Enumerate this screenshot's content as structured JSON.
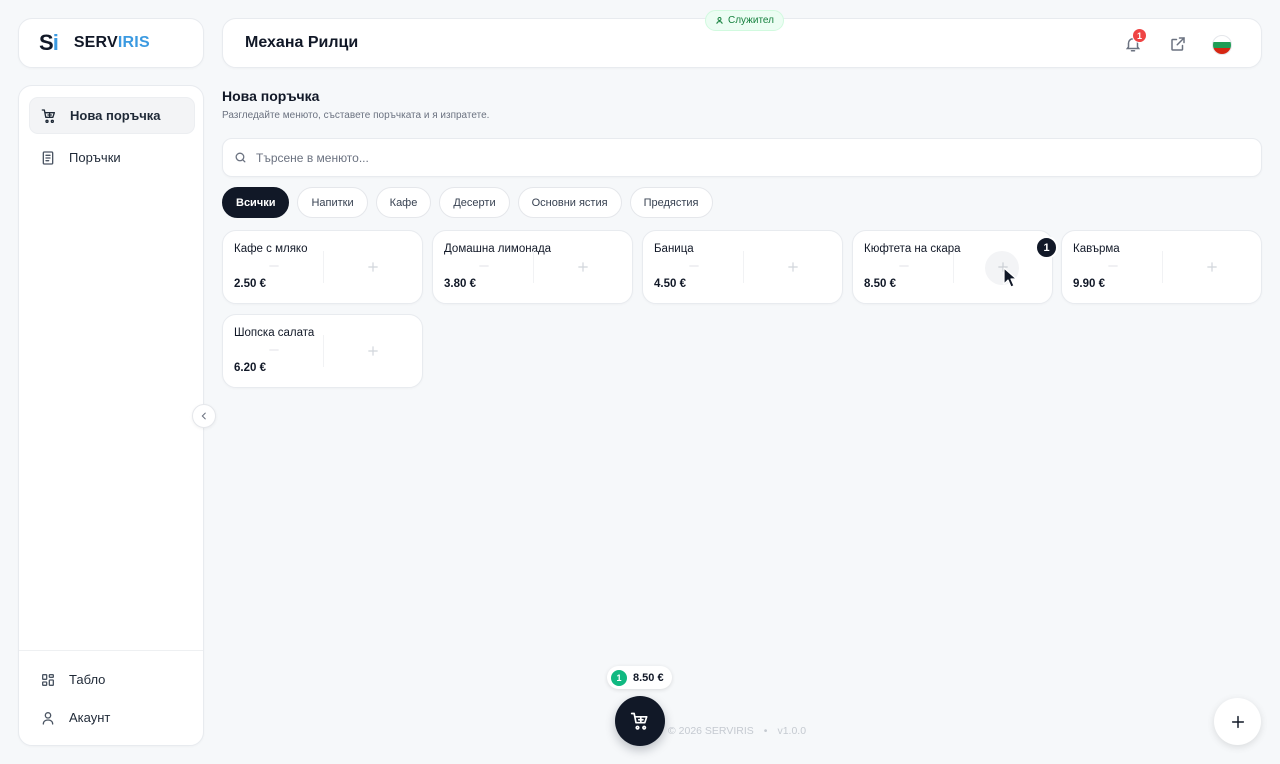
{
  "brand": {
    "mark": "S",
    "mark_accent": "i",
    "name_a": "SERV",
    "name_b": "IRIS"
  },
  "header": {
    "venue": "Механа Рилци",
    "role": "Служител",
    "notifications_count": "1"
  },
  "sidebar": {
    "items": [
      {
        "label": "Нова поръчка",
        "active": true
      },
      {
        "label": "Поръчки"
      }
    ],
    "bottom": [
      {
        "label": "Табло"
      },
      {
        "label": "Акаунт"
      }
    ]
  },
  "page": {
    "title": "Нова поръчка",
    "subtitle": "Разгледайте менюто, съставете поръчката и я изпратете."
  },
  "search": {
    "placeholder": "Търсене в менюто...",
    "value": ""
  },
  "categories": [
    {
      "label": "Всички",
      "active": true
    },
    {
      "label": "Напитки"
    },
    {
      "label": "Кафе"
    },
    {
      "label": "Десерти"
    },
    {
      "label": "Основни ястия"
    },
    {
      "label": "Предястия"
    }
  ],
  "products": [
    {
      "name": "Кафе с мляко",
      "price": "2.50 €"
    },
    {
      "name": "Домашна лимонада",
      "price": "3.80 €"
    },
    {
      "name": "Баница",
      "price": "4.50 €"
    },
    {
      "name": "Кюфтета на скара",
      "price": "8.50 €",
      "qty": "1"
    },
    {
      "name": "Кавърма",
      "price": "9.90 €"
    },
    {
      "name": "Шопска салата",
      "price": "6.20 €"
    }
  ],
  "cart": {
    "count": "1",
    "total": "8.50 €"
  },
  "footer": {
    "copyright": "© 2026 SERVIRIS",
    "separator": "•",
    "version": "v1.0.0"
  },
  "colors": {
    "accent": "#3b9ae1",
    "dark": "#111827",
    "success": "#10b981",
    "danger": "#ef4444"
  }
}
